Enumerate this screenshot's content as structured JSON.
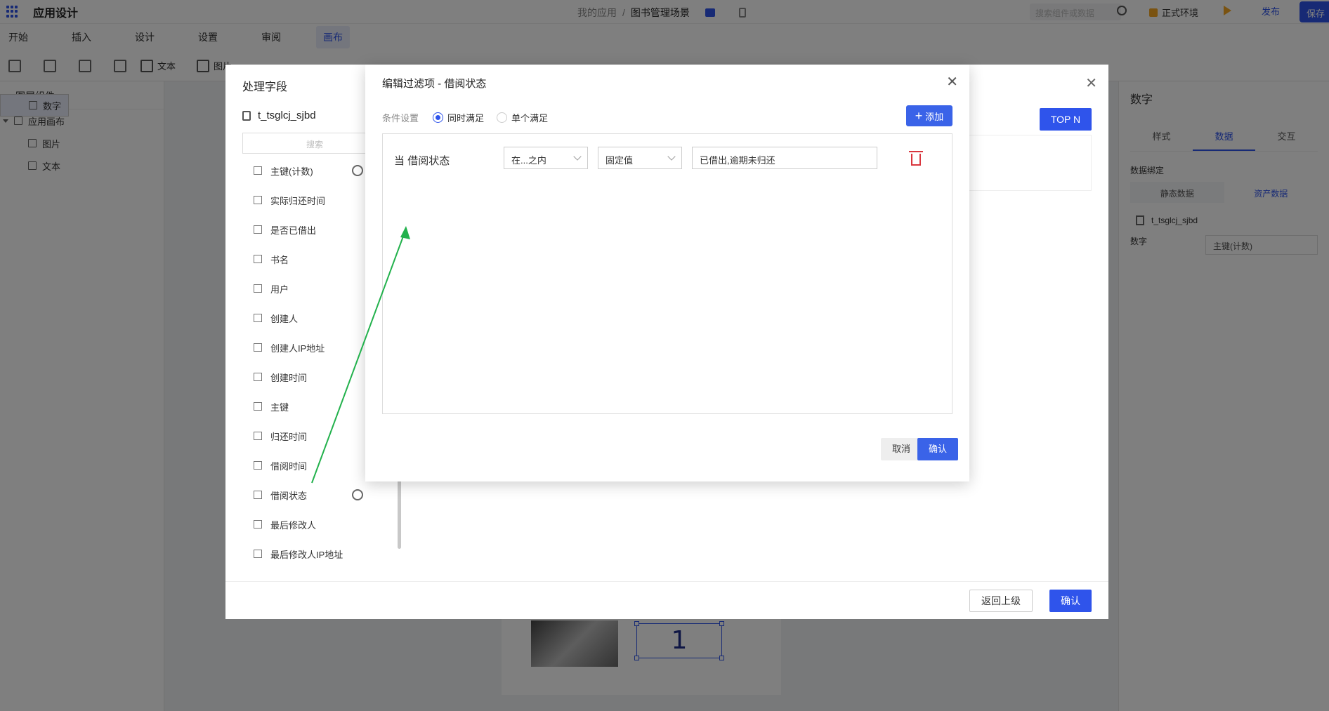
{
  "topbar": {
    "app_title": "应用设计",
    "breadcrumb_root": "我的应用",
    "breadcrumb_sep": "/",
    "breadcrumb_current": "图书管理场景",
    "search_placeholder": "搜索组件或数据",
    "env_label": "正式环境",
    "publish_label": "发布",
    "save_label": "保存"
  },
  "menu": {
    "items": [
      "开始",
      "插入",
      "设计",
      "设置",
      "审阅",
      "画布"
    ],
    "active": "画布"
  },
  "toolbar": {
    "text_label": "文本",
    "image_label": "图片"
  },
  "left_panel": {
    "title": "图层组件",
    "tree": {
      "root": "应用画布",
      "children": [
        "图片",
        "文本",
        "数字"
      ],
      "selected": "数字"
    }
  },
  "canvas": {
    "number_value": "1"
  },
  "right_panel": {
    "title": "数字",
    "tabs": [
      "样式",
      "数据",
      "交互"
    ],
    "active_tab": "数据",
    "binding_label": "数据绑定",
    "binding_options": [
      "静态数据",
      "资产数据"
    ],
    "binding_active": "资产数据",
    "table_name": "t_tsglcj_sjbd",
    "field_label": "数字",
    "field_value": "主键(计数)"
  },
  "outer_dialog": {
    "title": "处理字段",
    "table_name": "t_tsglcj_sjbd",
    "search_placeholder": "搜索",
    "topn_label": "TOP N",
    "fields": [
      {
        "name": "主键(计数)",
        "icon": "number-field-icon"
      },
      {
        "name": "实际归还时间",
        "icon": "date-field-icon"
      },
      {
        "name": "是否已借出",
        "icon": "number-field-icon"
      },
      {
        "name": "书名",
        "icon": "text-field-icon"
      },
      {
        "name": "用户",
        "icon": "text-field-icon"
      },
      {
        "name": "创建人",
        "icon": "text-field-icon"
      },
      {
        "name": "创建人IP地址",
        "icon": "text-field-icon"
      },
      {
        "name": "创建时间",
        "icon": "date-field-icon"
      },
      {
        "name": "主键",
        "icon": "text-field-icon"
      },
      {
        "name": "归还时间",
        "icon": "date-field-icon"
      },
      {
        "name": "借阅时间",
        "icon": "date-field-icon"
      },
      {
        "name": "借阅状态",
        "icon": "text-field-icon"
      },
      {
        "name": "最后修改人",
        "icon": "text-field-icon"
      },
      {
        "name": "最后修改人IP地址",
        "icon": "text-field-icon"
      }
    ],
    "back_label": "返回上级",
    "confirm_label": "确认"
  },
  "inner_dialog": {
    "title": "编辑过滤项 - 借阅状态",
    "condition_label": "条件设置",
    "radio_all": "同时满足",
    "radio_any": "单个满足",
    "selected_radio": "同时满足",
    "add_label": "添加",
    "rule": {
      "when_prefix": "当",
      "field": "借阅状态",
      "operator": "在...之内",
      "value_type": "固定值",
      "value": "已借出,逾期未归还"
    },
    "cancel_label": "取消",
    "confirm_label": "确认"
  },
  "colors": {
    "primary": "#2f54eb",
    "danger": "#d9363e",
    "annotation_arrow": "#22b14c"
  }
}
